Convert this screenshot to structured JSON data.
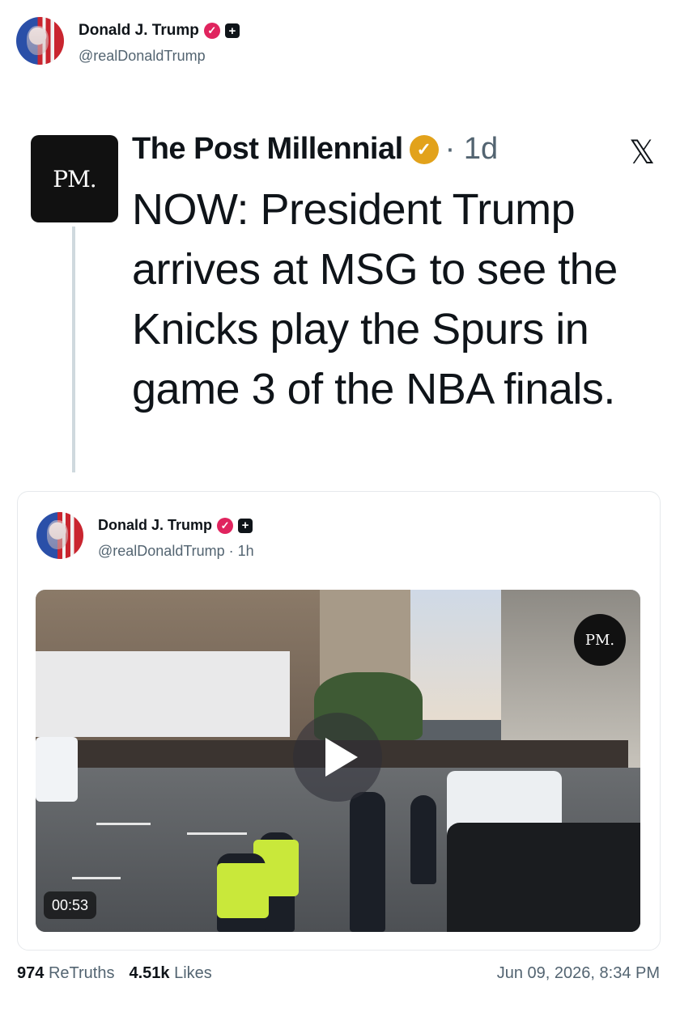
{
  "post": {
    "author_name": "Donald J. Trump",
    "author_handle": "@realDonaldTrump"
  },
  "x_post": {
    "logo_text": "PM.",
    "source_name": "The Post Millennial",
    "time": "· 1d",
    "x_icon": "x-logo-icon",
    "text": "NOW: President Trump arrives at MSG to see the Knicks play the Spurs in game 3 of the NBA finals."
  },
  "quoted": {
    "author_name": "Donald J. Trump",
    "author_meta": "@realDonaldTrump · 1h",
    "video": {
      "badge_text": "PM.",
      "duration": "00:53",
      "play_icon": "play-icon"
    }
  },
  "footer": {
    "retruths_count": "974",
    "retruths_label": "ReTruths",
    "likes_count": "4.51k",
    "likes_label": "Likes",
    "timestamp": "Jun 09, 2026, 8:34 PM"
  },
  "colors": {
    "verified_badge": "#e0245e",
    "gold_check": "#e2a21b",
    "secondary_text": "#536471"
  }
}
